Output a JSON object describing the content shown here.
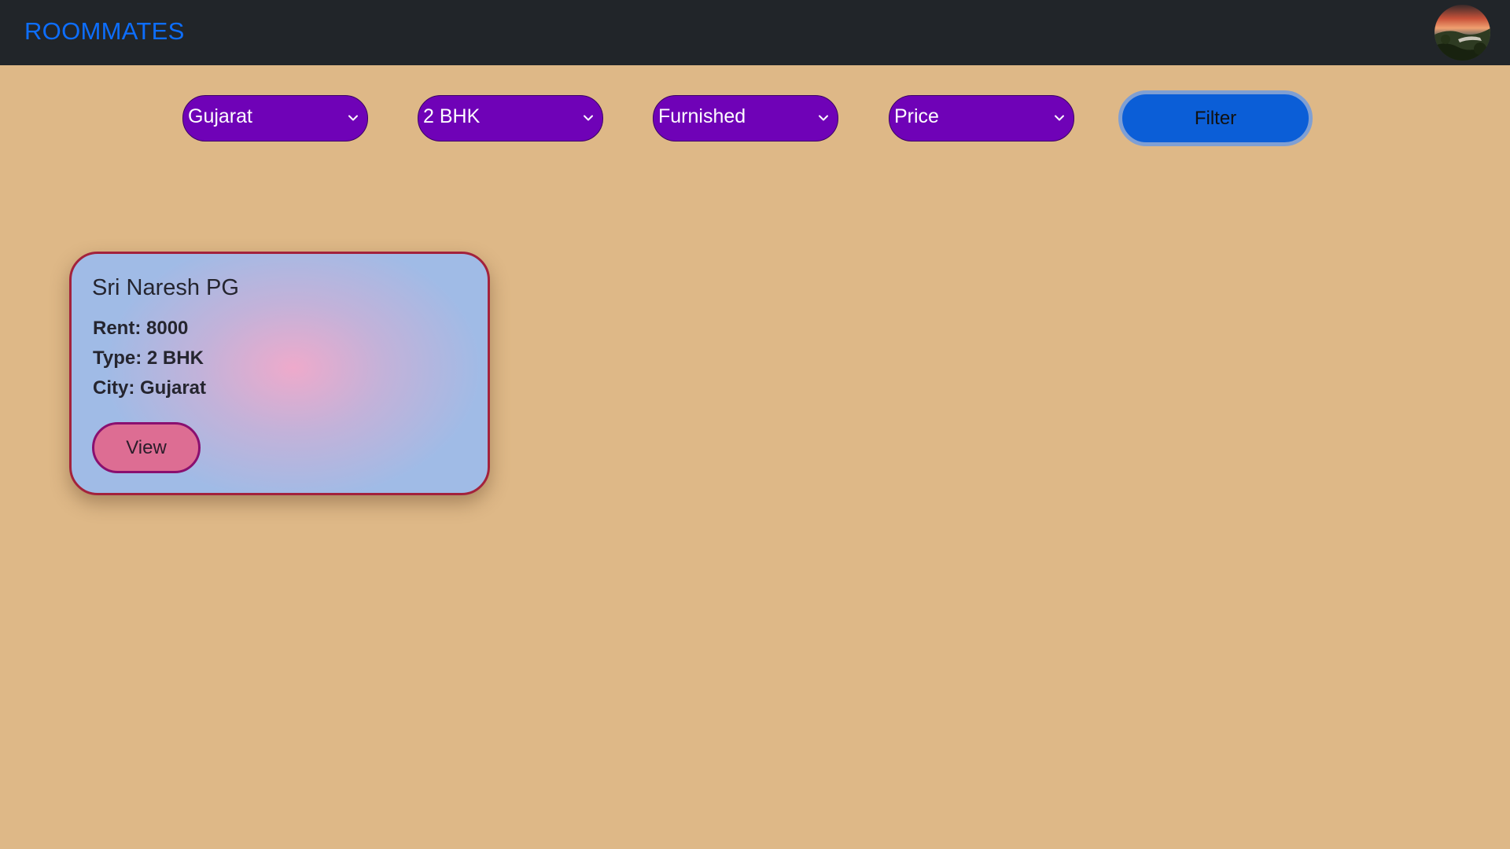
{
  "navbar": {
    "brand": "ROOMMATES",
    "avatar_icon": "user-avatar-photo"
  },
  "filters": {
    "state": {
      "selected": "Gujarat"
    },
    "bhk": {
      "selected": "2 BHK"
    },
    "furnishing": {
      "selected": "Furnished"
    },
    "price": {
      "selected": "Price"
    },
    "chevron_icon": "chevron-down-icon",
    "button_label": "Filter"
  },
  "listings": [
    {
      "title": "Sri Naresh PG",
      "rent": "Rent: 8000",
      "type": "Type: 2 BHK",
      "city": "City: Gujarat",
      "button_label": "View"
    }
  ],
  "colors": {
    "page_background": "#deb887",
    "navbar_background": "#212529",
    "brand": "#0d6efd",
    "dropdown": "#6f02b7",
    "filter_button": "#0b5ed7",
    "card_border": "#a3223c",
    "view_button": "#dd6d93"
  }
}
